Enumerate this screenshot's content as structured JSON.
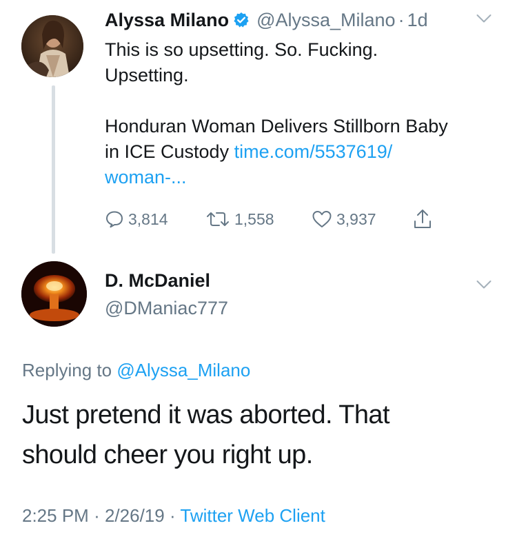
{
  "tweet": {
    "author_name": "Alyssa Milano",
    "author_handle": "@Alyssa_Milano",
    "separator": "·",
    "age": "1d",
    "text_line1": "This is so upsetting. So. Fucking.",
    "text_line2": "Upsetting.",
    "headline_part1": "Honduran Woman Delivers Stillborn Baby",
    "headline_part2": "in ICE Custody",
    "link_part1": "time.com/5537619/",
    "link_part2": "woman-...",
    "reply_count": "3,814",
    "retweet_count": "1,558",
    "like_count": "3,937",
    "icons": {
      "reply": "reply-bubble-icon",
      "retweet": "retweet-icon",
      "like": "heart-icon",
      "share": "share-icon",
      "verified": "verified-badge-icon",
      "menu": "chevron-down-icon"
    }
  },
  "reply": {
    "author_name": "D. McDaniel",
    "author_handle": "@DManiac777",
    "replying_prefix": "Replying to",
    "replying_to": "@Alyssa_Milano",
    "text_line1": "Just pretend it was aborted. That",
    "text_line2": "should cheer you right up.",
    "time": "2:25 PM",
    "date": "2/26/19",
    "separator": "·",
    "client": "Twitter Web Client"
  },
  "colors": {
    "accent": "#1da1f2",
    "secondary_text": "#657786",
    "primary_text": "#14171a",
    "thread_line": "#d8dee3"
  }
}
